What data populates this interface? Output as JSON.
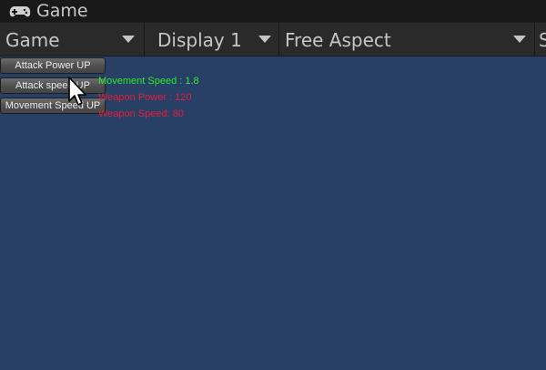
{
  "window": {
    "title": "Game",
    "icon": "gamepad-icon"
  },
  "toolbar": {
    "view_mode": "Game",
    "display": "Display 1",
    "aspect": "Free Aspect",
    "overflow_label": "S"
  },
  "buttons": {
    "attack_power": "Attack Power UP",
    "attack_speed": "Attack speed UP",
    "movement_speed": "Movement Speed UP"
  },
  "stats": {
    "movement_speed": "Movement Speed : 1.8",
    "weapon_power": "Weapon Power : 120",
    "weapon_speed": "Weapon Speed: 80"
  },
  "colors": {
    "viewport_bg": "#283f66",
    "movement_speed_text": "#2ee82e",
    "weapon_text": "#e0203a"
  }
}
